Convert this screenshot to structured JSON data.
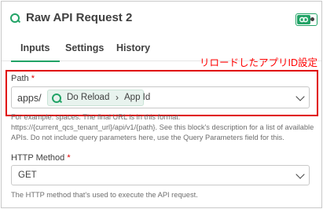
{
  "header": {
    "title": "Raw API Request 2",
    "icon": "qlik-circle-icon",
    "toggle_icon": "link-icon"
  },
  "tabs": [
    {
      "label": "Inputs",
      "active": true
    },
    {
      "label": "Settings",
      "active": false
    },
    {
      "label": "History",
      "active": false
    }
  ],
  "annotation": "リロードしたアプリID設定",
  "path_field": {
    "label": "Path",
    "required_mark": "*",
    "prefix": "apps/",
    "token_source": "Do Reload",
    "token_separator": "›",
    "token_field": "App Id",
    "help": "For example: spaces. The final URL is in this format: https://{current_qcs_tenant_url}/api/v1/{path}. See this block's description for a list of available APIs. Do not include query parameters here, use the Query Parameters field for this."
  },
  "method_field": {
    "label": "HTTP Method",
    "required_mark": "*",
    "value": "GET",
    "help": "The HTTP method that's used to execute the API request."
  },
  "colors": {
    "accent": "#21a366",
    "highlight_border": "#e00000",
    "annotation_text": "#ff0000"
  }
}
